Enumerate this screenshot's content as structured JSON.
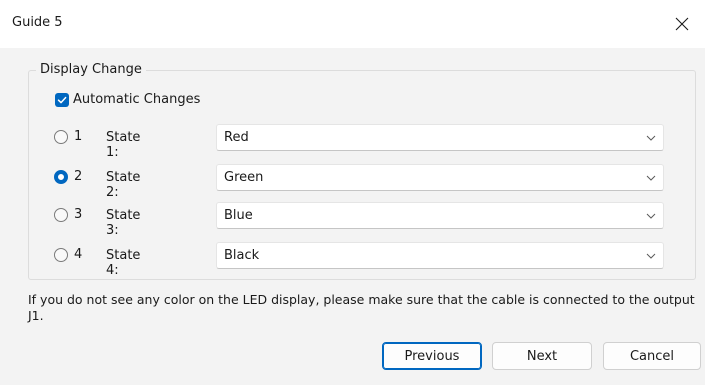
{
  "window": {
    "title": "Guide 5",
    "close_icon": "close-x-icon"
  },
  "group": {
    "legend": "Display Change",
    "automatic": {
      "label": "Automatic Changes",
      "checked": true,
      "accent": "#0067c0"
    },
    "states": [
      {
        "number": "1",
        "label": "State 1:",
        "value": "Red",
        "selected": false
      },
      {
        "number": "2",
        "label": "State 2:",
        "value": "Green",
        "selected": true
      },
      {
        "number": "3",
        "label": "State 3:",
        "value": "Blue",
        "selected": false
      },
      {
        "number": "4",
        "label": "State 4:",
        "value": "Black",
        "selected": false
      }
    ]
  },
  "info": {
    "text": "If you do not see any color on the LED display, please make sure that the cable is connected to the output J1."
  },
  "buttons": {
    "previous": "Previous",
    "next": "Next",
    "cancel": "Cancel"
  }
}
